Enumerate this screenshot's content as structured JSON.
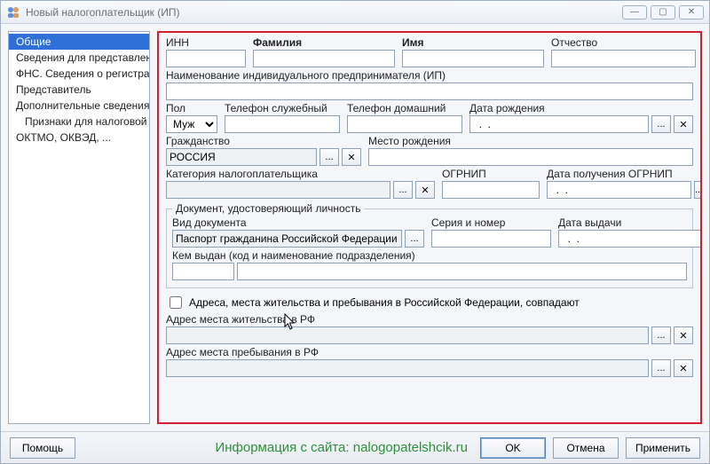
{
  "window": {
    "title": "Новый налогоплательщик (ИП)"
  },
  "nav": {
    "items": [
      {
        "label": "Общие",
        "selected": true
      },
      {
        "label": "Сведения для представлени",
        "selected": false
      },
      {
        "label": "ФНС. Сведения о регистрац",
        "selected": false
      },
      {
        "label": "Представитель",
        "selected": false
      },
      {
        "label": "Дополнительные сведения",
        "selected": false
      },
      {
        "label": "Признаки для налоговой о",
        "selected": false,
        "indent": true
      },
      {
        "label": "ОКТМО, ОКВЭД, ...",
        "selected": false
      }
    ]
  },
  "labels": {
    "inn": "ИНН",
    "surname": "Фамилия",
    "name": "Имя",
    "patronymic": "Отчество",
    "full_ip_name": "Наименование индивидуального предпринимателя (ИП)",
    "sex": "Пол",
    "work_phone": "Телефон служебный",
    "home_phone": "Телефон домашний",
    "birth_date": "Дата рождения",
    "citizenship": "Гражданство",
    "birth_place": "Место рождения",
    "taxpayer_category": "Категория налогоплательщика",
    "ogrnip": "ОГРНИП",
    "ogrnip_date": "Дата получения ОГРНИП",
    "doc_section": "Документ, удостоверяющий личность",
    "doc_type": "Вид документа",
    "doc_series": "Серия и номер",
    "doc_issue_date": "Дата выдачи",
    "issued_by": "Кем выдан (код и наименование подразделения)",
    "addr_same": "Адреса, места жительства и пребывания в Российской Федерации, совпадают",
    "addr_residence": "Адрес места жительства в РФ",
    "addr_stay": "Адрес места пребывания в РФ"
  },
  "values": {
    "inn": "",
    "surname": "",
    "name": "",
    "patronymic": "",
    "full_ip_name": "",
    "sex_selected": "Муж",
    "work_phone": "",
    "home_phone": "",
    "birth_date": "  .  .",
    "citizenship": "РОССИЯ",
    "birth_place": "",
    "taxpayer_category": "",
    "ogrnip": "",
    "ogrnip_date": "  .  .",
    "doc_type": "Паспорт гражданина Российской Федерации",
    "doc_series": "",
    "doc_issue_date": "  .  .",
    "issued_code": "",
    "issued_name": "",
    "addr_same_checked": false,
    "addr_residence": "",
    "addr_stay": ""
  },
  "footer": {
    "help": "Помощь",
    "ok": "OK",
    "cancel": "Отмена",
    "apply": "Применить",
    "watermark": "Информация с сайта: nalogopatelshcik.ru"
  },
  "glyphs": {
    "ellipsis": "...",
    "clear": "✕",
    "min": "—",
    "max": "▢",
    "close": "✕"
  }
}
